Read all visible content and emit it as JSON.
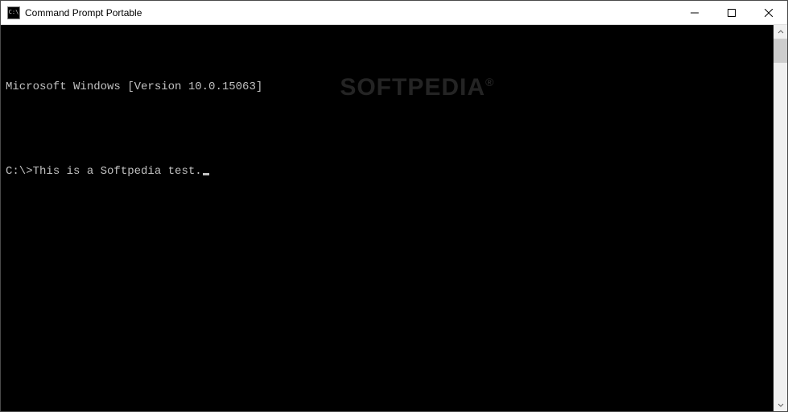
{
  "window": {
    "title": "Command Prompt Portable",
    "icon_label": "C:\\"
  },
  "terminal": {
    "line1": "Microsoft Windows [Version 10.0.15063]",
    "blank": "",
    "prompt": "C:\\>",
    "input": "This is a Softpedia test."
  },
  "watermark": {
    "text": "SOFTPEDIA",
    "reg": "®"
  }
}
